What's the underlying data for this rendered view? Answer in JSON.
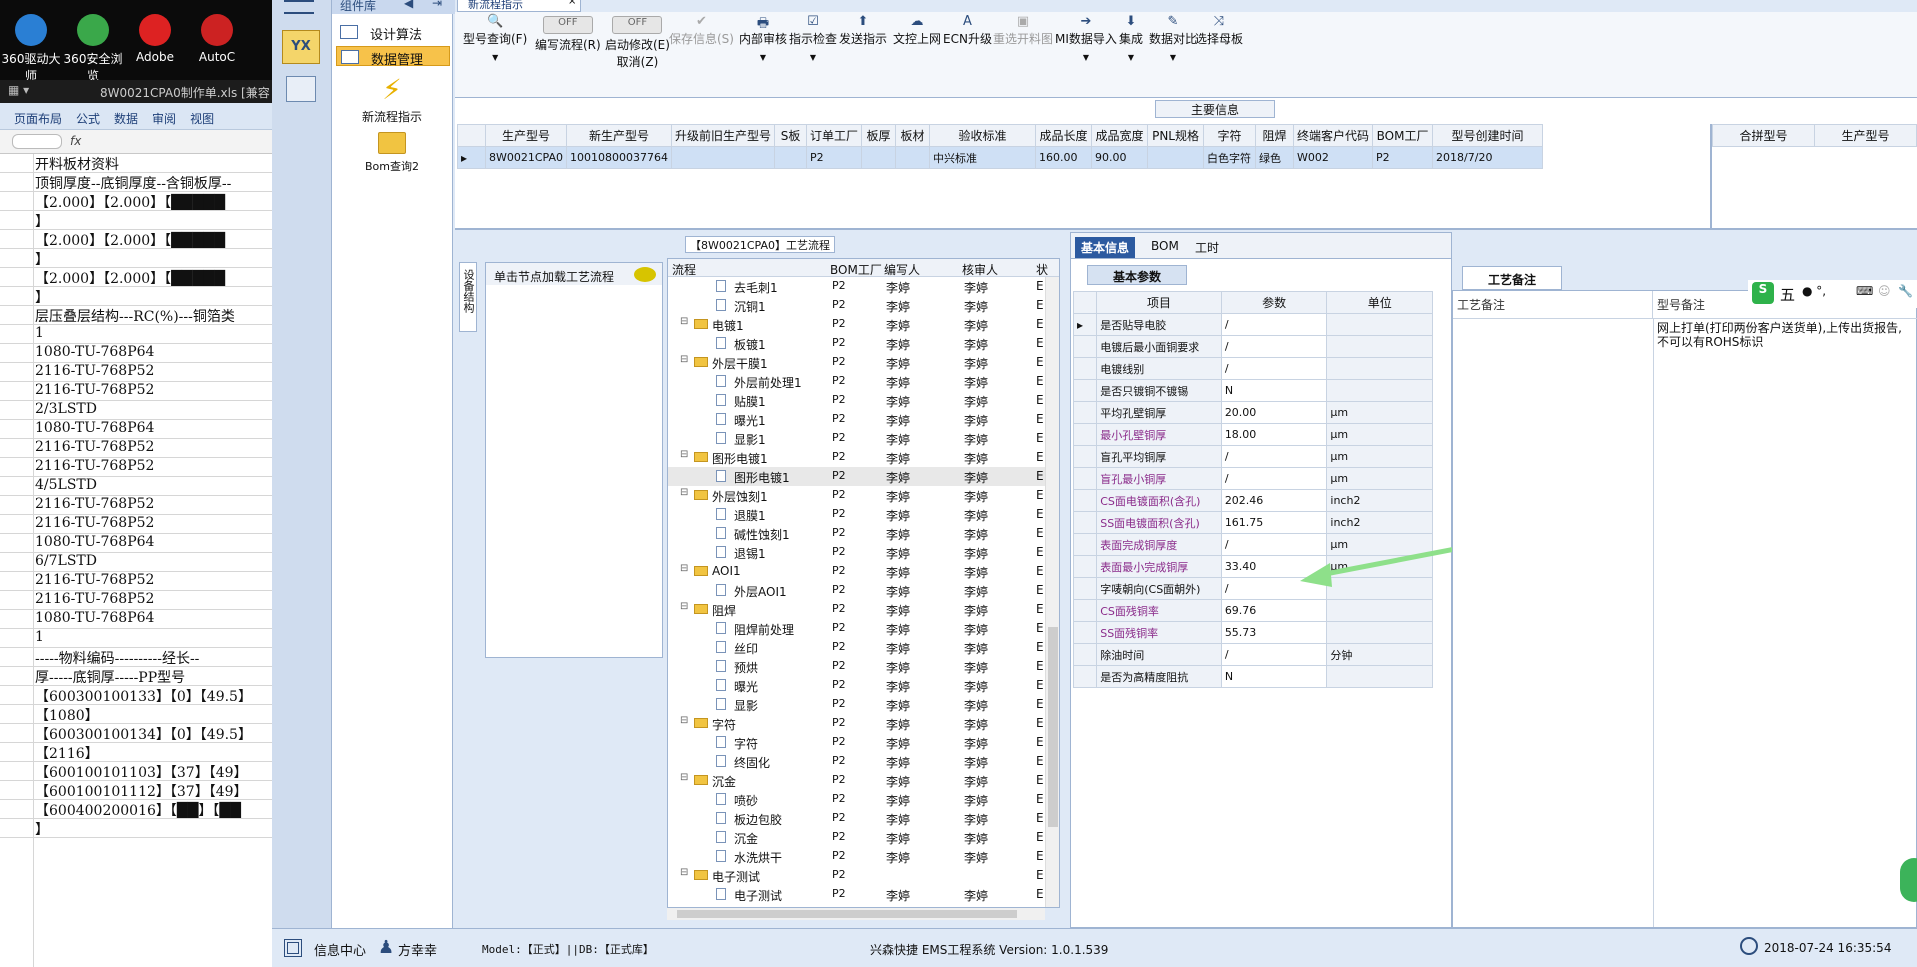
{
  "desktop": {
    "icons": [
      {
        "label": "360驱动大师",
        "color": "#2a7fd4"
      },
      {
        "label": "360安全浏览",
        "color": "#3aa84a"
      },
      {
        "label": "Adobe",
        "color": "#d22"
      },
      {
        "label": "AutoC",
        "color": "#c22"
      }
    ]
  },
  "excel": {
    "title": "8W0021CPA0制作单.xls [兼容",
    "ribbon_tabs": [
      "页面布局",
      "公式",
      "数据",
      "审阅",
      "视图"
    ],
    "fx": "fx",
    "rows": [
      "开料板材资料",
      "顶铜厚度--底铜厚度--含铜板厚--",
      "【2.000】【2.000】【█████",
      "】",
      "【2.000】【2.000】【█████",
      "】",
      "【2.000】【2.000】【█████",
      "】",
      "层压叠层结构---RC(%)---铜箔类",
      "1",
      "1080-TU-768P64",
      "2116-TU-768P52",
      "2116-TU-768P52",
      "2/3LSTD",
      "1080-TU-768P64",
      "2116-TU-768P52",
      "2116-TU-768P52",
      "4/5LSTD",
      "2116-TU-768P52",
      "2116-TU-768P52",
      "1080-TU-768P64",
      "6/7LSTD",
      "2116-TU-768P52",
      "2116-TU-768P52",
      "1080-TU-768P64",
      "1",
      "-----物料编码----------经长--",
      "厚-----底铜厚-----PP型号",
      "【600300100133】【0】【49.5】",
      "【1080】",
      "【600300100134】【0】【49.5】",
      "【2116】",
      "【600100101103】【37】【49】",
      "【600100101112】【37】【49】",
      "【600400200016】【██】【██",
      "】"
    ]
  },
  "app": {
    "tab_widget_lib": "组件库",
    "tab_new_flow": "新流程指示",
    "logo": "YX",
    "nav_items": [
      "设计算法",
      "数据管理"
    ],
    "nav_actions": [
      {
        "label": "新流程指示",
        "icon": "lightning-icon"
      },
      {
        "label": "Bom查询2",
        "icon": "folder-icon"
      }
    ],
    "toolbar": [
      {
        "label": "型号查询(F)",
        "glyph": "🔍",
        "dropdown": true,
        "disabled": false
      },
      {
        "label": "编写流程(R)",
        "glyph": "OFF",
        "dropdown": false,
        "disabled": false
      },
      {
        "label": "启动修改(E)",
        "sub": "取消(Z)",
        "glyph": "OFF",
        "dropdown": false,
        "disabled": false
      },
      {
        "label": "保存信息(S)",
        "glyph": "✔",
        "dropdown": false,
        "disabled": true
      },
      {
        "label": "内部审核",
        "glyph": "🖶",
        "dropdown": true,
        "disabled": false
      },
      {
        "label": "指示检查",
        "glyph": "☑",
        "dropdown": true,
        "disabled": false
      },
      {
        "label": "发送指示",
        "glyph": "⬆",
        "dropdown": false,
        "disabled": false
      },
      {
        "label": "文控上网",
        "glyph": "☁",
        "dropdown": false,
        "disabled": false
      },
      {
        "label": "ECN升级",
        "glyph": "A",
        "dropdown": false,
        "disabled": false
      },
      {
        "label": "重选开料图",
        "glyph": "▣",
        "dropdown": false,
        "disabled": true
      },
      {
        "label": "MI数据导入",
        "glyph": "➔",
        "dropdown": true,
        "disabled": false
      },
      {
        "label": "集成",
        "glyph": "⬇",
        "dropdown": true,
        "disabled": false
      },
      {
        "label": "数据对比",
        "glyph": "✎",
        "dropdown": true,
        "disabled": false
      },
      {
        "label": "选择母板",
        "glyph": "⤨",
        "dropdown": false,
        "disabled": false
      }
    ],
    "main_info": {
      "title": "主要信息",
      "columns": [
        "生产型号",
        "新生产型号",
        "升级前旧生产型号",
        "S板",
        "订单工厂",
        "板厚",
        "板材",
        "验收标准",
        "成品长度",
        "成品宽度",
        "PNL规格",
        "字符",
        "阻焊",
        "终端客户代码",
        "BOM工厂",
        "型号创建时间"
      ],
      "row": [
        "8W0021CPA0",
        "10010800037764",
        "",
        "",
        "P2",
        "",
        "",
        "中兴标准",
        "160.00",
        "90.00",
        "",
        "白色字符",
        "绿色",
        "W002",
        "P2",
        "2018/7/20"
      ],
      "side_columns": [
        "合拼型号",
        "生产型号"
      ]
    },
    "process": {
      "title": "【8W0021CPA0】工艺流程",
      "side_tab": "设备结构",
      "hint": "单击节点加载工艺流程",
      "columns": [
        "流程",
        "BOM工厂",
        "编写人",
        "核审人",
        "状"
      ],
      "rows": [
        {
          "name": "去毛刺1",
          "level": 2,
          "bom": "P2",
          "writer": "李婷",
          "reviewer": "李婷",
          "st": "E"
        },
        {
          "name": "沉铜1",
          "level": 2,
          "bom": "P2",
          "writer": "李婷",
          "reviewer": "李婷",
          "st": "E"
        },
        {
          "name": "电镀1",
          "level": 1,
          "bom": "P2",
          "writer": "李婷",
          "reviewer": "李婷",
          "st": "E"
        },
        {
          "name": "板镀1",
          "level": 2,
          "bom": "P2",
          "writer": "李婷",
          "reviewer": "李婷",
          "st": "E"
        },
        {
          "name": "外层干膜1",
          "level": 1,
          "bom": "P2",
          "writer": "李婷",
          "reviewer": "李婷",
          "st": "E"
        },
        {
          "name": "外层前处理1",
          "level": 2,
          "bom": "P2",
          "writer": "李婷",
          "reviewer": "李婷",
          "st": "E"
        },
        {
          "name": "贴膜1",
          "level": 2,
          "bom": "P2",
          "writer": "李婷",
          "reviewer": "李婷",
          "st": "E"
        },
        {
          "name": "曝光1",
          "level": 2,
          "bom": "P2",
          "writer": "李婷",
          "reviewer": "李婷",
          "st": "E"
        },
        {
          "name": "显影1",
          "level": 2,
          "bom": "P2",
          "writer": "李婷",
          "reviewer": "李婷",
          "st": "E"
        },
        {
          "name": "图形电镀1",
          "level": 1,
          "bom": "P2",
          "writer": "李婷",
          "reviewer": "李婷",
          "st": "E"
        },
        {
          "name": "图形电镀1",
          "level": 2,
          "bom": "P2",
          "writer": "李婷",
          "reviewer": "李婷",
          "st": "E",
          "selected": true
        },
        {
          "name": "外层蚀刻1",
          "level": 1,
          "bom": "P2",
          "writer": "李婷",
          "reviewer": "李婷",
          "st": "E"
        },
        {
          "name": "退膜1",
          "level": 2,
          "bom": "P2",
          "writer": "李婷",
          "reviewer": "李婷",
          "st": "E"
        },
        {
          "name": "碱性蚀刻1",
          "level": 2,
          "bom": "P2",
          "writer": "李婷",
          "reviewer": "李婷",
          "st": "E"
        },
        {
          "name": "退锡1",
          "level": 2,
          "bom": "P2",
          "writer": "李婷",
          "reviewer": "李婷",
          "st": "E"
        },
        {
          "name": "AOI1",
          "level": 1,
          "bom": "P2",
          "writer": "李婷",
          "reviewer": "李婷",
          "st": "E"
        },
        {
          "name": "外层AOI1",
          "level": 2,
          "bom": "P2",
          "writer": "李婷",
          "reviewer": "李婷",
          "st": "E"
        },
        {
          "name": "阻焊",
          "level": 1,
          "bom": "P2",
          "writer": "李婷",
          "reviewer": "李婷",
          "st": "E"
        },
        {
          "name": "阻焊前处理",
          "level": 2,
          "bom": "P2",
          "writer": "李婷",
          "reviewer": "李婷",
          "st": "E"
        },
        {
          "name": "丝印",
          "level": 2,
          "bom": "P2",
          "writer": "李婷",
          "reviewer": "李婷",
          "st": "E"
        },
        {
          "name": "预烘",
          "level": 2,
          "bom": "P2",
          "writer": "李婷",
          "reviewer": "李婷",
          "st": "E"
        },
        {
          "name": "曝光",
          "level": 2,
          "bom": "P2",
          "writer": "李婷",
          "reviewer": "李婷",
          "st": "E"
        },
        {
          "name": "显影",
          "level": 2,
          "bom": "P2",
          "writer": "李婷",
          "reviewer": "李婷",
          "st": "E"
        },
        {
          "name": "字符",
          "level": 1,
          "bom": "P2",
          "writer": "李婷",
          "reviewer": "李婷",
          "st": "E"
        },
        {
          "name": "字符",
          "level": 2,
          "bom": "P2",
          "writer": "李婷",
          "reviewer": "李婷",
          "st": "E"
        },
        {
          "name": "终固化",
          "level": 2,
          "bom": "P2",
          "writer": "李婷",
          "reviewer": "李婷",
          "st": "E"
        },
        {
          "name": "沉金",
          "level": 1,
          "bom": "P2",
          "writer": "李婷",
          "reviewer": "李婷",
          "st": "E"
        },
        {
          "name": "喷砂",
          "level": 2,
          "bom": "P2",
          "writer": "李婷",
          "reviewer": "李婷",
          "st": "E"
        },
        {
          "name": "板边包胶",
          "level": 2,
          "bom": "P2",
          "writer": "李婷",
          "reviewer": "李婷",
          "st": "E"
        },
        {
          "name": "沉金",
          "level": 2,
          "bom": "P2",
          "writer": "李婷",
          "reviewer": "李婷",
          "st": "E"
        },
        {
          "name": "水洗烘干",
          "level": 2,
          "bom": "P2",
          "writer": "李婷",
          "reviewer": "李婷",
          "st": "E"
        },
        {
          "name": "电子测试",
          "level": 1,
          "bom": "P2",
          "writer": "",
          "reviewer": "",
          "st": "E"
        },
        {
          "name": "电子测试",
          "level": 2,
          "bom": "P2",
          "writer": "李婷",
          "reviewer": "李婷",
          "st": "E"
        }
      ]
    },
    "basic": {
      "tabs": [
        "基本信息",
        "BOM",
        "工时"
      ],
      "sub_tab": "基本参数",
      "columns": [
        "项目",
        "参数",
        "单位"
      ],
      "rows": [
        {
          "item": "是否贴导电胶",
          "value": "/",
          "unit": "",
          "hl": false
        },
        {
          "item": "电镀后最小面铜要求",
          "value": "/",
          "unit": "",
          "hl": false
        },
        {
          "item": "电镀线别",
          "value": "/",
          "unit": "",
          "hl": false
        },
        {
          "item": "是否只镀铜不镀锡",
          "value": "N",
          "unit": "",
          "hl": false
        },
        {
          "item": "平均孔壁铜厚",
          "value": "20.00",
          "unit": "μm",
          "hl": false
        },
        {
          "item": "最小孔壁铜厚",
          "value": "18.00",
          "unit": "μm",
          "hl": true
        },
        {
          "item": "盲孔平均铜厚",
          "value": "/",
          "unit": "μm",
          "hl": false
        },
        {
          "item": "盲孔最小铜厚",
          "value": "/",
          "unit": "μm",
          "hl": true
        },
        {
          "item": "CS面电镀面积(含孔)",
          "value": "202.46",
          "unit": "inch2",
          "hl": true
        },
        {
          "item": "SS面电镀面积(含孔)",
          "value": "161.75",
          "unit": "inch2",
          "hl": true
        },
        {
          "item": "表面完成铜厚度",
          "value": "/",
          "unit": "μm",
          "hl": true
        },
        {
          "item": "表面最小完成铜厚",
          "value": "33.40",
          "unit": "μm",
          "hl": true
        },
        {
          "item": "字唛朝向(CS面朝外)",
          "value": "/",
          "unit": "",
          "hl": false
        },
        {
          "item": "CS面残铜率",
          "value": "69.76",
          "unit": "",
          "hl": true
        },
        {
          "item": "SS面残铜率",
          "value": "55.73",
          "unit": "",
          "hl": true
        },
        {
          "item": "除油时间",
          "value": "/",
          "unit": "分钟",
          "hl": false
        },
        {
          "item": "是否为高精度阻抗",
          "value": "N",
          "unit": "",
          "hl": false
        }
      ]
    },
    "remark": {
      "tab": "工艺备注",
      "col1": "工艺备注",
      "col2": "型号备注",
      "text": "网上打单(打印两份客户送货单),上传出货报告,不可以有ROHS标识"
    },
    "status": {
      "info_center": "信息中心",
      "user": "方幸幸",
      "model": "Model:【正式】||DB:【正式库】",
      "system": "兴森快捷 EMS工程系统  Version: 1.0.1.539",
      "datetime": "2018-07-24 16:35:54"
    },
    "ime": "五"
  }
}
